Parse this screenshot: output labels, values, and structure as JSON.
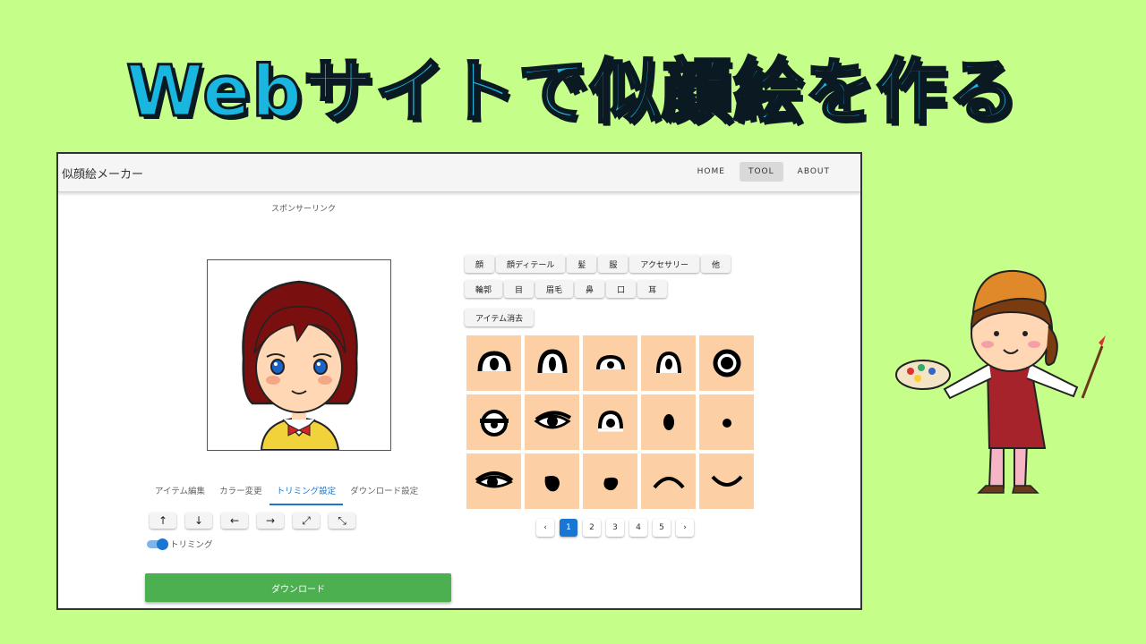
{
  "banner": {
    "title": "Webサイトで似顔絵を作る"
  },
  "app": {
    "title": "似顔絵メーカー",
    "nav": [
      "HOME",
      "TOOL",
      "ABOUT"
    ],
    "sponsor": "スポンサーリンク",
    "tabs": [
      "アイテム編集",
      "カラー変更",
      "トリミング設定",
      "ダウンロード設定"
    ],
    "arrow_buttons": [
      "↑",
      "↓",
      "←",
      "→",
      "⤢",
      "⤡"
    ],
    "toggle_label": "トリミング",
    "download_label": "ダウンロード",
    "categories_row1": [
      "顔",
      "顔ディテール",
      "髪",
      "服",
      "アクセサリー",
      "他"
    ],
    "categories_row2": [
      "輪郭",
      "目",
      "眉毛",
      "鼻",
      "口",
      "耳"
    ],
    "clear_label": "アイテム消去",
    "pages": [
      "1",
      "2",
      "3",
      "4",
      "5"
    ],
    "prev_icon": "‹",
    "next_icon": "›"
  },
  "colors": {
    "background": "#c6fe8a",
    "accent": "#1976d2",
    "download": "#4caf50",
    "cell": "#fcd0a4",
    "banner_text": "#19b7e0"
  }
}
